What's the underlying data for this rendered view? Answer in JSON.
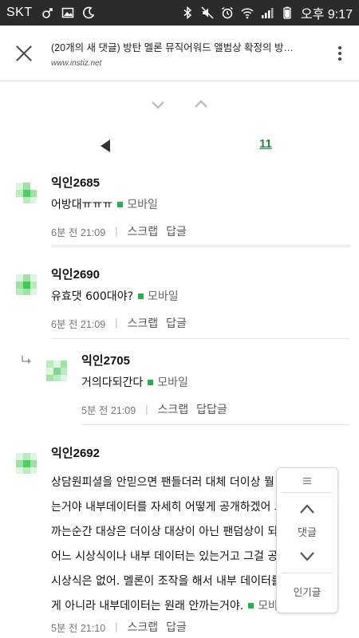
{
  "status_bar": {
    "carrier": "SKT",
    "time": "오후 9:17",
    "icons": [
      "gender-icon",
      "image-icon",
      "moon-icon",
      "bluetooth-icon",
      "mute-icon",
      "alarm-icon",
      "wifi-icon",
      "signal-icon",
      "battery-icon"
    ]
  },
  "top_bar": {
    "title": "(20개의 새 댓글) 방탄 멜론 뮤직어워드 앨범상 확정의 방…",
    "url": "www.instiz.net",
    "close_icon": "close-icon",
    "more_icon": "more-vertical-icon"
  },
  "sort": {
    "down_icon": "chevron-down-icon",
    "up_icon": "chevron-up-icon"
  },
  "pager": {
    "prev_icon": "triangle-left-icon",
    "page": "11"
  },
  "comments": [
    {
      "name": "익인2685",
      "body": "어방대ㅠㅠㅠ",
      "device": "모바일",
      "time": "6분 전 21:09",
      "actions": [
        "스크랩",
        "답글"
      ],
      "reply": false
    },
    {
      "name": "익인2690",
      "body": "유효댓 600대야?",
      "device": "모바일",
      "time": "6분 전 21:09",
      "actions": [
        "스크랩",
        "답글"
      ],
      "reply": false
    },
    {
      "name": "익인2705",
      "body": "거의다되간다",
      "device": "모바일",
      "time": "5분 전 21:09",
      "actions": [
        "스크랩",
        "답답글"
      ],
      "reply": true
    },
    {
      "name": "익인2692",
      "body_lines": [
        "상담원피셜을 안믿으면 팬들더러 대체 더이상 뭘 어떡하라",
        "는거야 내부데이터를 자세히 어떻게 공개하겠어 그리고 데",
        "까는순간 대상은 더이상 대상이 아닌 팬덤상이 되는거야.",
        "어느 시상식이나 내부 데이터는 있는거고 그걸 공개하는",
        "시상식은 없어. 멜론이 조작을 해서 내부 데이터를 안까는",
        "게 아니라 내부데이터는 원래 안까는거야."
      ],
      "device": "모바일",
      "time": "5분 전 21:10",
      "actions": [
        "스크랩",
        "답글"
      ],
      "reply": false
    }
  ],
  "float_nav": {
    "handle_icon": "drag-handle-icon",
    "up_icon": "chevron-up-icon",
    "label": "댓글",
    "down_icon": "chevron-down-icon",
    "popular": "인기글"
  },
  "colors": {
    "accent_green": "#22b34a",
    "page_link": "#1e8a3c",
    "status_bar_bg": "#2b2b2b"
  }
}
